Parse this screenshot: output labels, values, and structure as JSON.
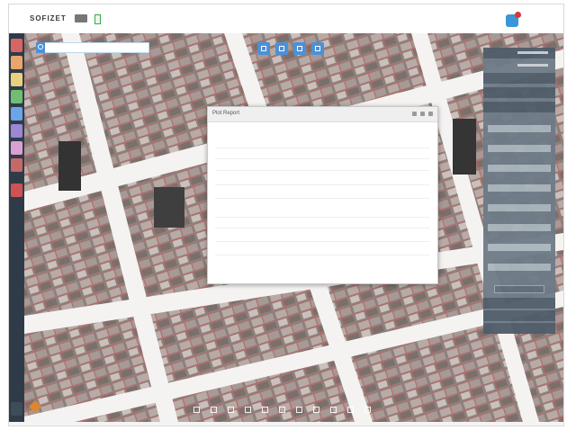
{
  "topbar": {
    "logo": "SOFIZET",
    "mode": "",
    "alert": ""
  },
  "search": {
    "placeholder": ""
  },
  "rail_buttons": [
    "#d86464",
    "#eaa56a",
    "#e9d17d",
    "#6fbe72",
    "#6da4e6",
    "#9b87d4",
    "#d9a0d1",
    "#c56868",
    "#cf5353"
  ],
  "right_panel": {
    "rows": [
      "",
      "",
      "",
      "",
      "",
      "",
      "",
      "",
      ""
    ],
    "field_labels": [
      "",
      "",
      "",
      "",
      "",
      "",
      "",
      "",
      ""
    ],
    "button": ""
  },
  "popup": {
    "title": "Plot Report",
    "rows": [
      {
        "label": "",
        "value": ""
      },
      {
        "label": "",
        "value": ""
      },
      {
        "label": "",
        "value": ""
      },
      {
        "label": "",
        "value": ""
      },
      {
        "label": "",
        "value": ""
      },
      {
        "label": "",
        "value": ""
      },
      {
        "label": "",
        "value": ""
      },
      {
        "label": "",
        "value": ""
      },
      {
        "label": "",
        "value": ""
      },
      {
        "label": "",
        "value": ""
      }
    ]
  },
  "bottom_tools": [
    "tool-1",
    "tool-2",
    "tool-3",
    "tool-4",
    "tool-5",
    "tool-6",
    "tool-7",
    "tool-8",
    "tool-9",
    "tool-10",
    "tool-11"
  ]
}
